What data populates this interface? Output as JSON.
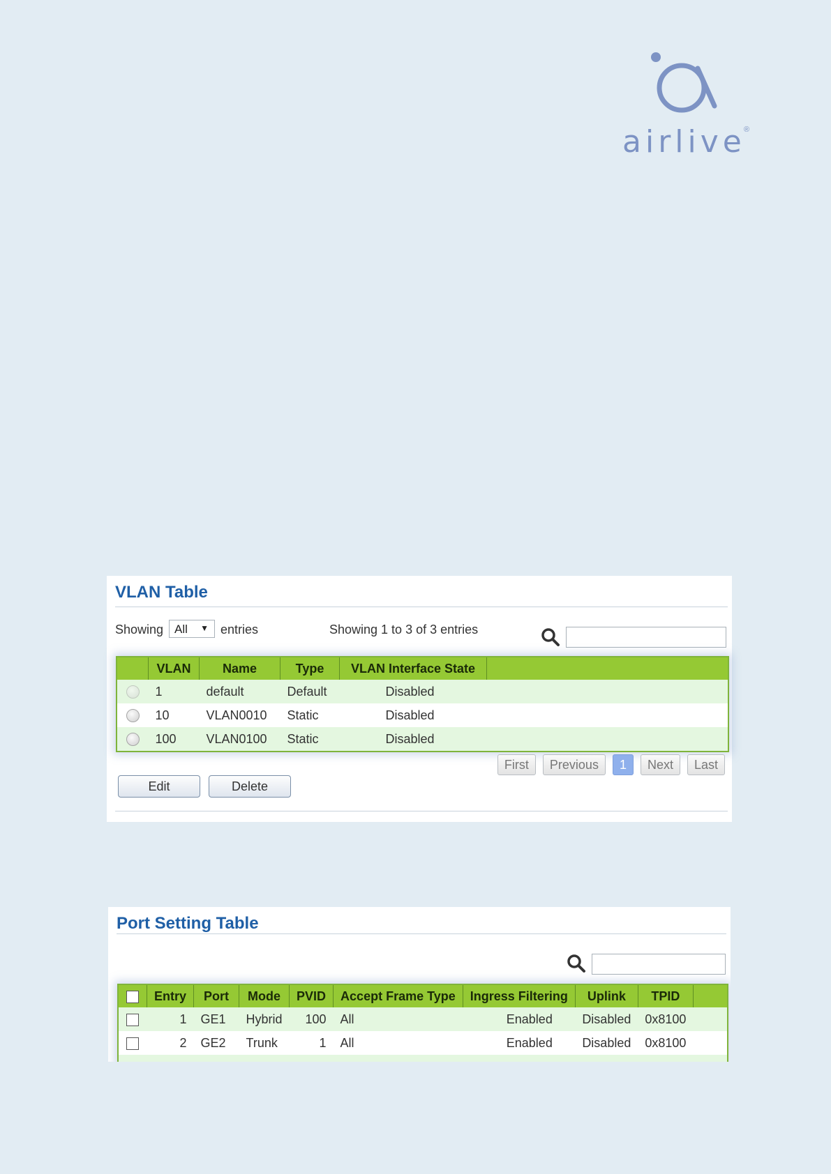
{
  "logo": {
    "text": "airlive",
    "reg": "®"
  },
  "vlan_table": {
    "title": "VLAN Table",
    "showing_label": "Showing",
    "entries_select": "All",
    "entries_label": "entries",
    "summary": "Showing 1 to 3 of 3 entries",
    "search_placeholder": "",
    "columns": [
      "VLAN",
      "Name",
      "Type",
      "VLAN Interface State"
    ],
    "rows": [
      {
        "vlan": "1",
        "name": "default",
        "type": "Default",
        "state": "Disabled",
        "selectable": false
      },
      {
        "vlan": "10",
        "name": "VLAN0010",
        "type": "Static",
        "state": "Disabled",
        "selectable": true
      },
      {
        "vlan": "100",
        "name": "VLAN0100",
        "type": "Static",
        "state": "Disabled",
        "selectable": true
      }
    ],
    "pager": {
      "first": "First",
      "previous": "Previous",
      "current": "1",
      "next": "Next",
      "last": "Last"
    },
    "edit_label": "Edit",
    "delete_label": "Delete"
  },
  "port_table": {
    "title": "Port Setting Table",
    "search_placeholder": "",
    "columns": [
      "Entry",
      "Port",
      "Mode",
      "PVID",
      "Accept Frame Type",
      "Ingress Filtering",
      "Uplink",
      "TPID"
    ],
    "rows": [
      {
        "entry": "1",
        "port": "GE1",
        "mode": "Hybrid",
        "pvid": "100",
        "accept": "All",
        "ingress": "Enabled",
        "uplink": "Disabled",
        "tpid": "0x8100"
      },
      {
        "entry": "2",
        "port": "GE2",
        "mode": "Trunk",
        "pvid": "1",
        "accept": "All",
        "ingress": "Enabled",
        "uplink": "Disabled",
        "tpid": "0x8100"
      }
    ]
  },
  "colors": {
    "header_green": "#95c934",
    "row_alt": "#e4f7e0",
    "title_blue": "#1f5fa6",
    "page_bg": "#e2ecf3"
  }
}
